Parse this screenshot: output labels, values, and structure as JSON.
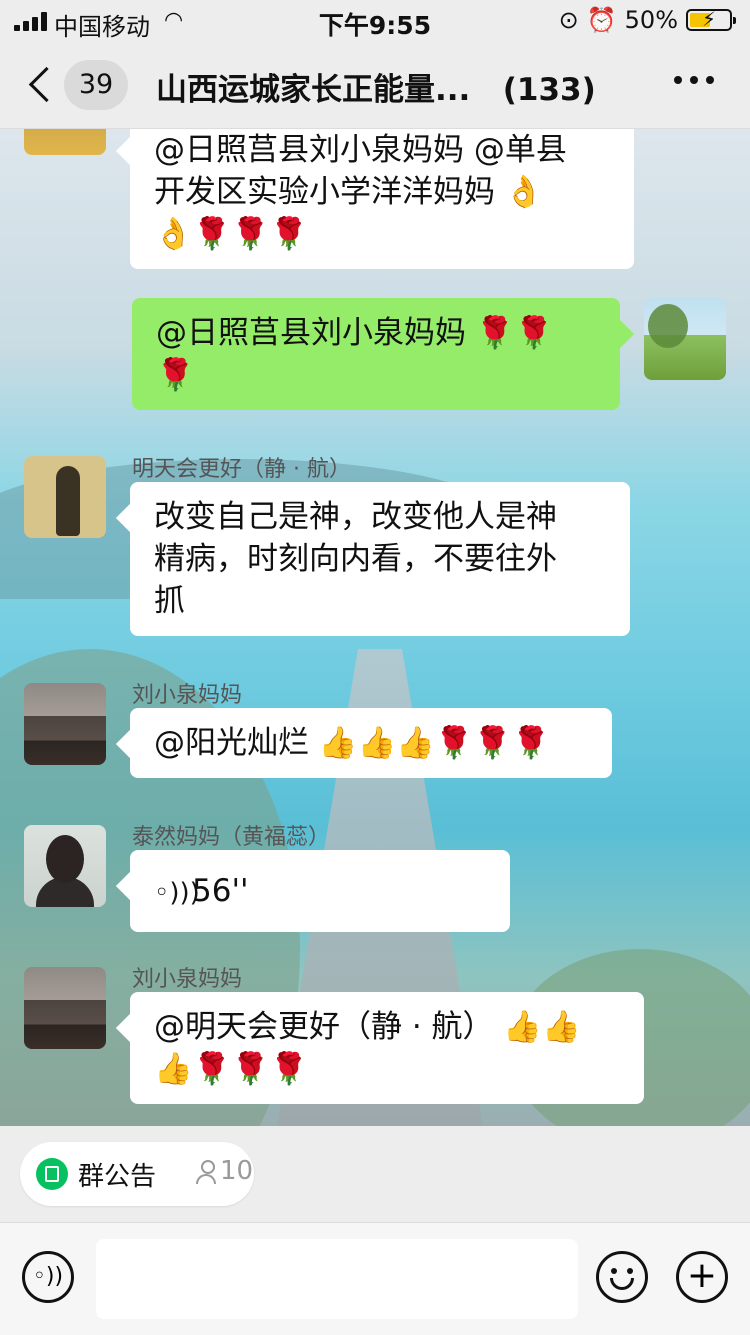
{
  "status_bar": {
    "carrier": "中国移动",
    "time": "下午9:55",
    "battery": "50%",
    "battery_level": 0.5
  },
  "nav": {
    "unread_count": "39",
    "title": "山西运城家长正能量...",
    "member_count": "(133)"
  },
  "messages": [
    {
      "type": "text",
      "side": "left",
      "lines": [
        "@日照莒县刘小泉妈妈 @单县",
        "开发区实验小学洋洋妈妈 👌",
        "👌🌹🌹🌹"
      ]
    },
    {
      "type": "text",
      "side": "right",
      "lines": [
        "@日照莒县刘小泉妈妈 🌹🌹",
        "🌹"
      ]
    },
    {
      "type": "text",
      "side": "left",
      "sender": "明天会更好（静 · 航）",
      "lines": [
        "改变自己是神，改变他人是神",
        "精病，时刻向内看，不要往外",
        "抓"
      ]
    },
    {
      "type": "text",
      "side": "left",
      "sender": "刘小泉妈妈",
      "lines": [
        "@阳光灿烂 👍👍👍🌹🌹🌹"
      ]
    },
    {
      "type": "voice",
      "side": "left",
      "sender": "泰然妈妈（黄福蕊）",
      "duration": "56''"
    },
    {
      "type": "text",
      "side": "left",
      "sender": "刘小泉妈妈",
      "lines": [
        "@明天会更好（静 · 航） 👍👍",
        "👍🌹🌹🌹"
      ]
    }
  ],
  "announcement": {
    "label": "群公告",
    "count": "10"
  },
  "input_bar": {
    "placeholder": ""
  },
  "colors": {
    "green_bubble": "#95ec69",
    "accent": "#07c160"
  }
}
